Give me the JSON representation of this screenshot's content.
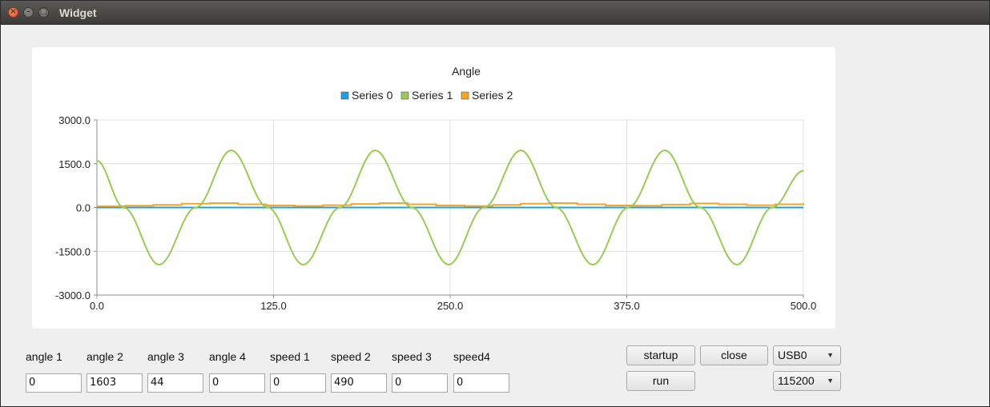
{
  "window": {
    "title": "Widget"
  },
  "titlebar": {
    "close_glyph": "×",
    "min_glyph": "–",
    "max_glyph": "□"
  },
  "chart_data": {
    "type": "line",
    "title": "Angle",
    "xlabel": "",
    "ylabel": "",
    "xlim": [
      0,
      500
    ],
    "ylim": [
      -3000,
      3000
    ],
    "x_ticks": [
      "0.0",
      "125.0",
      "250.0",
      "375.0",
      "500.0"
    ],
    "y_ticks": [
      "3000.0",
      "1500.0",
      "0.0",
      "-1500.0",
      "-3000.0"
    ],
    "grid": true,
    "legend_position": "top-center",
    "series": [
      {
        "name": "Series 0",
        "color": "#209fdf",
        "x": [
          0,
          500
        ],
        "y": [
          0,
          0
        ]
      },
      {
        "name": "Series 1",
        "color": "#99ca53",
        "x": [
          0,
          19,
          44,
          70,
          95,
          121,
          146,
          172,
          197,
          223,
          249,
          274,
          300,
          325,
          351,
          376,
          402,
          427,
          453,
          478,
          500
        ],
        "y": [
          1603,
          0,
          -1960,
          0,
          1960,
          0,
          -1960,
          0,
          1960,
          0,
          -1960,
          0,
          1960,
          0,
          -1960,
          0,
          1960,
          0,
          -1960,
          0,
          1260
        ]
      },
      {
        "name": "Series 2",
        "color": "#f6a625",
        "x": [
          0,
          20,
          40,
          60,
          80,
          100,
          120,
          140,
          160,
          180,
          200,
          220,
          240,
          260,
          280,
          300,
          320,
          340,
          360,
          380,
          400,
          420,
          440,
          460,
          480,
          500
        ],
        "y": [
          44,
          60,
          90,
          130,
          150,
          110,
          70,
          50,
          80,
          120,
          150,
          110,
          70,
          50,
          90,
          130,
          150,
          110,
          70,
          60,
          100,
          140,
          110,
          80,
          110,
          150
        ]
      }
    ]
  },
  "fields": [
    {
      "label": "angle 1",
      "value": "0"
    },
    {
      "label": "angle 2",
      "value": "1603"
    },
    {
      "label": "angle 3",
      "value": "44"
    },
    {
      "label": "angle 4",
      "value": "0"
    },
    {
      "label": "speed 1",
      "value": "0"
    },
    {
      "label": "speed 2",
      "value": "490"
    },
    {
      "label": "speed 3",
      "value": "0"
    },
    {
      "label": "speed4",
      "value": "0"
    }
  ],
  "buttons": {
    "startup": "startup",
    "close": "close",
    "run": "run"
  },
  "port_select": {
    "value": "USB0",
    "arrow": "▼"
  },
  "baud_select": {
    "value": "115200",
    "arrow": "▼"
  }
}
